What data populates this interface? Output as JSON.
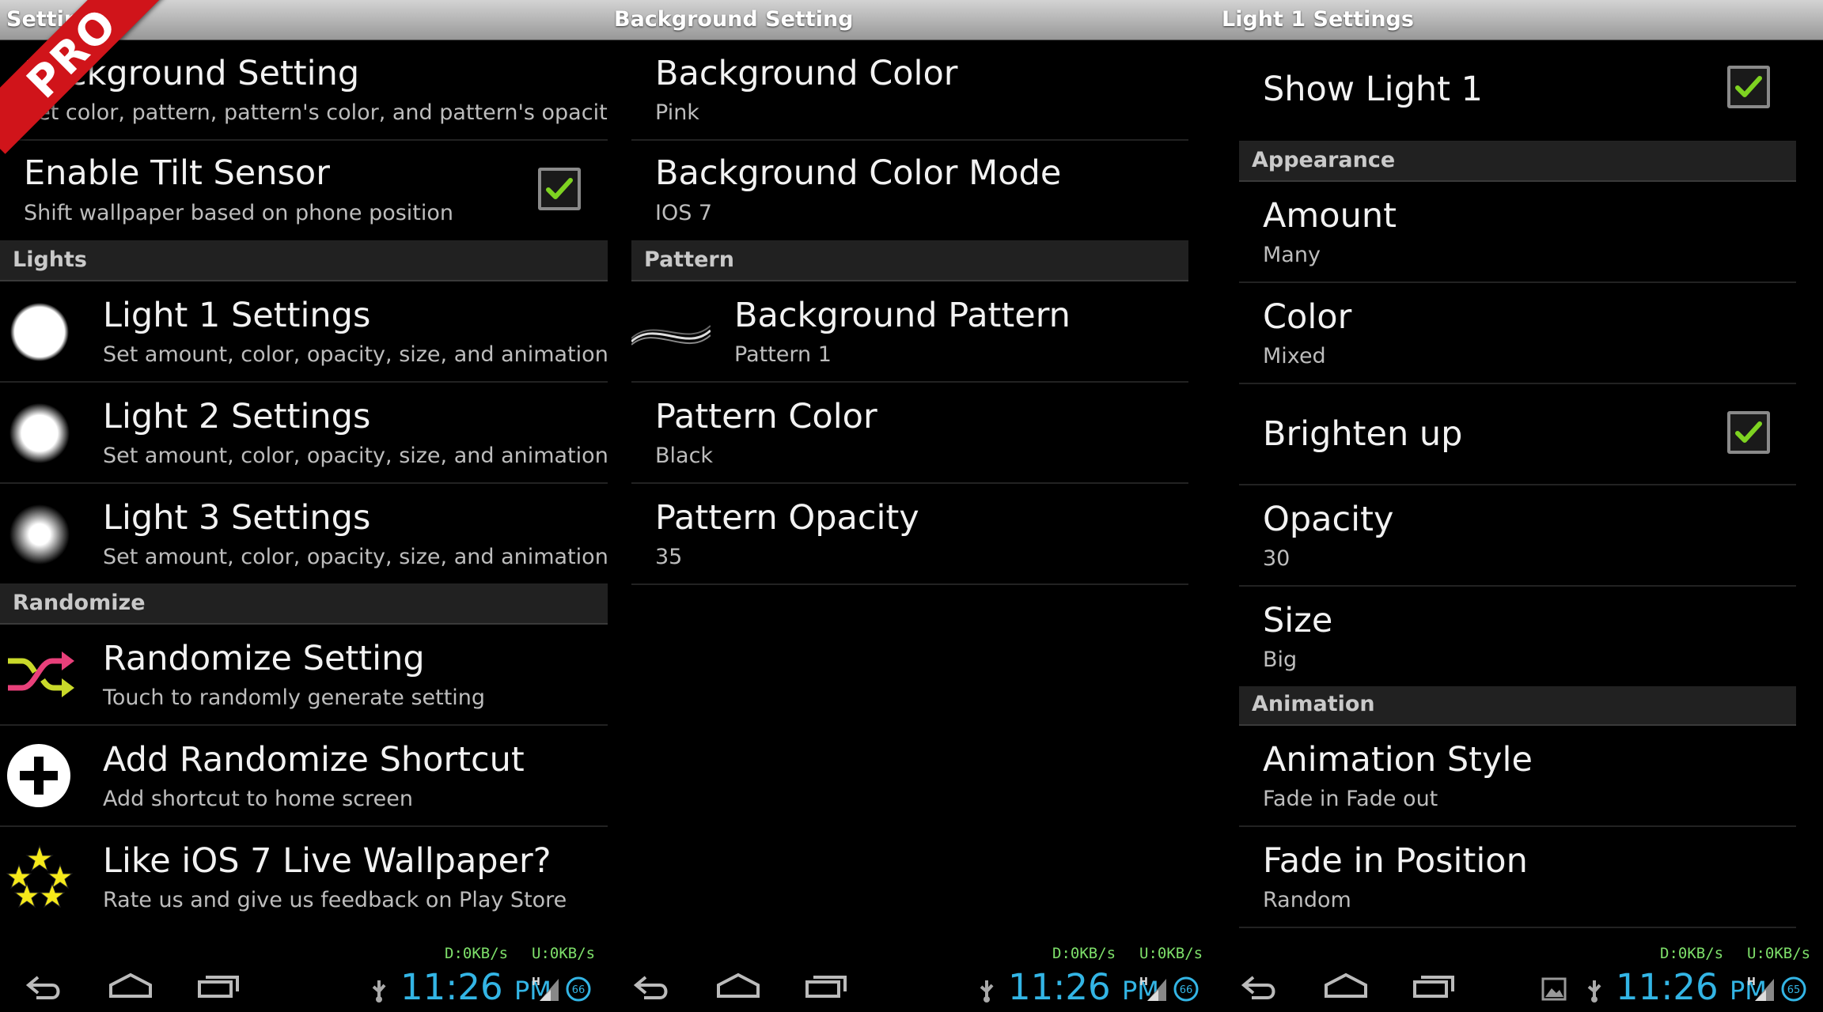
{
  "panel1": {
    "title": "Setting",
    "badge": "PRO",
    "items": [
      {
        "title": "Background Setting",
        "subtitle": "Set color, pattern, pattern's color, and pattern's opacity"
      },
      {
        "title": "Enable Tilt Sensor",
        "subtitle": "Shift wallpaper based on phone position",
        "checked": true
      }
    ],
    "section_lights": "Lights",
    "lights": [
      {
        "title": "Light 1 Settings",
        "subtitle": "Set amount, color, opacity, size, and animation"
      },
      {
        "title": "Light 2 Settings",
        "subtitle": "Set amount, color, opacity, size, and animation"
      },
      {
        "title": "Light 3 Settings",
        "subtitle": "Set amount, color, opacity, size, and animation"
      }
    ],
    "section_randomize": "Randomize",
    "randomize": [
      {
        "title": "Randomize Setting",
        "subtitle": "Touch to randomly generate setting",
        "icon": "shuffle-icon"
      },
      {
        "title": "Add Randomize Shortcut",
        "subtitle": "Add shortcut to home screen",
        "icon": "plus-circle-icon"
      },
      {
        "title": "Like iOS 7 Live Wallpaper?",
        "subtitle": "Rate us and give us feedback on Play Store",
        "icon": "stars-icon"
      }
    ]
  },
  "panel2": {
    "title": "Background Setting",
    "items": [
      {
        "title": "Background Color",
        "subtitle": "Pink"
      },
      {
        "title": "Background Color Mode",
        "subtitle": "IOS 7"
      }
    ],
    "section_pattern": "Pattern",
    "pattern_items": [
      {
        "title": "Background Pattern",
        "subtitle": "Pattern 1"
      },
      {
        "title": "Pattern Color",
        "subtitle": "Black"
      },
      {
        "title": "Pattern Opacity",
        "subtitle": "35"
      }
    ]
  },
  "panel3": {
    "title": "Light 1 Settings",
    "show_light": {
      "title": "Show Light 1",
      "checked": true
    },
    "section_appearance": "Appearance",
    "appearance": [
      {
        "title": "Amount",
        "subtitle": "Many"
      },
      {
        "title": "Color",
        "subtitle": "Mixed"
      }
    ],
    "brighten": {
      "title": "Brighten up",
      "checked": true
    },
    "appearance2": [
      {
        "title": "Opacity",
        "subtitle": "30"
      },
      {
        "title": "Size",
        "subtitle": "Big"
      }
    ],
    "section_animation": "Animation",
    "animation": [
      {
        "title": "Animation Style",
        "subtitle": "Fade in Fade out"
      },
      {
        "title": "Fade in Position",
        "subtitle": "Random"
      }
    ]
  },
  "statusbar": {
    "download": "D:0KB/s",
    "upload": "U:0KB/s",
    "time": "11:26",
    "ampm": "PM",
    "battery_p1": "66",
    "battery_p2": "66",
    "battery_p3": "65"
  },
  "colors": {
    "accent_clock": "#33b5e5",
    "check_green": "#7ed321",
    "pro_red": "#d0141a"
  }
}
